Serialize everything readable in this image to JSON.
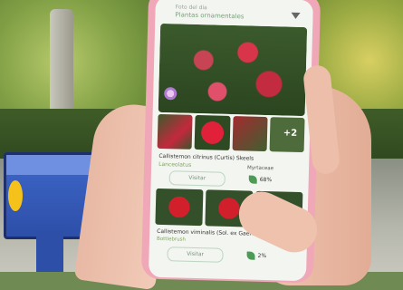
{
  "app": {
    "header_sub": "Foto del día",
    "header_title": "Plantas ornamentales",
    "result1": {
      "name": "Callistemon citrinus (Curtis) Skeels",
      "family": "Lanceolatus",
      "tag": "Myrtaceae",
      "button": "Visitar",
      "score": "68%"
    },
    "more_badge": "+2",
    "result2": {
      "name": "Callistemon viminalis (Sol. ex Gaertn.)",
      "family": "Bottlebrush",
      "button": "Visitar",
      "score": "2%"
    }
  },
  "colors": {
    "bench": "#3e67c9",
    "phone_case": "#f0a7b8",
    "flower_red": "#d21f2c",
    "accent_green": "#7ea35c"
  }
}
